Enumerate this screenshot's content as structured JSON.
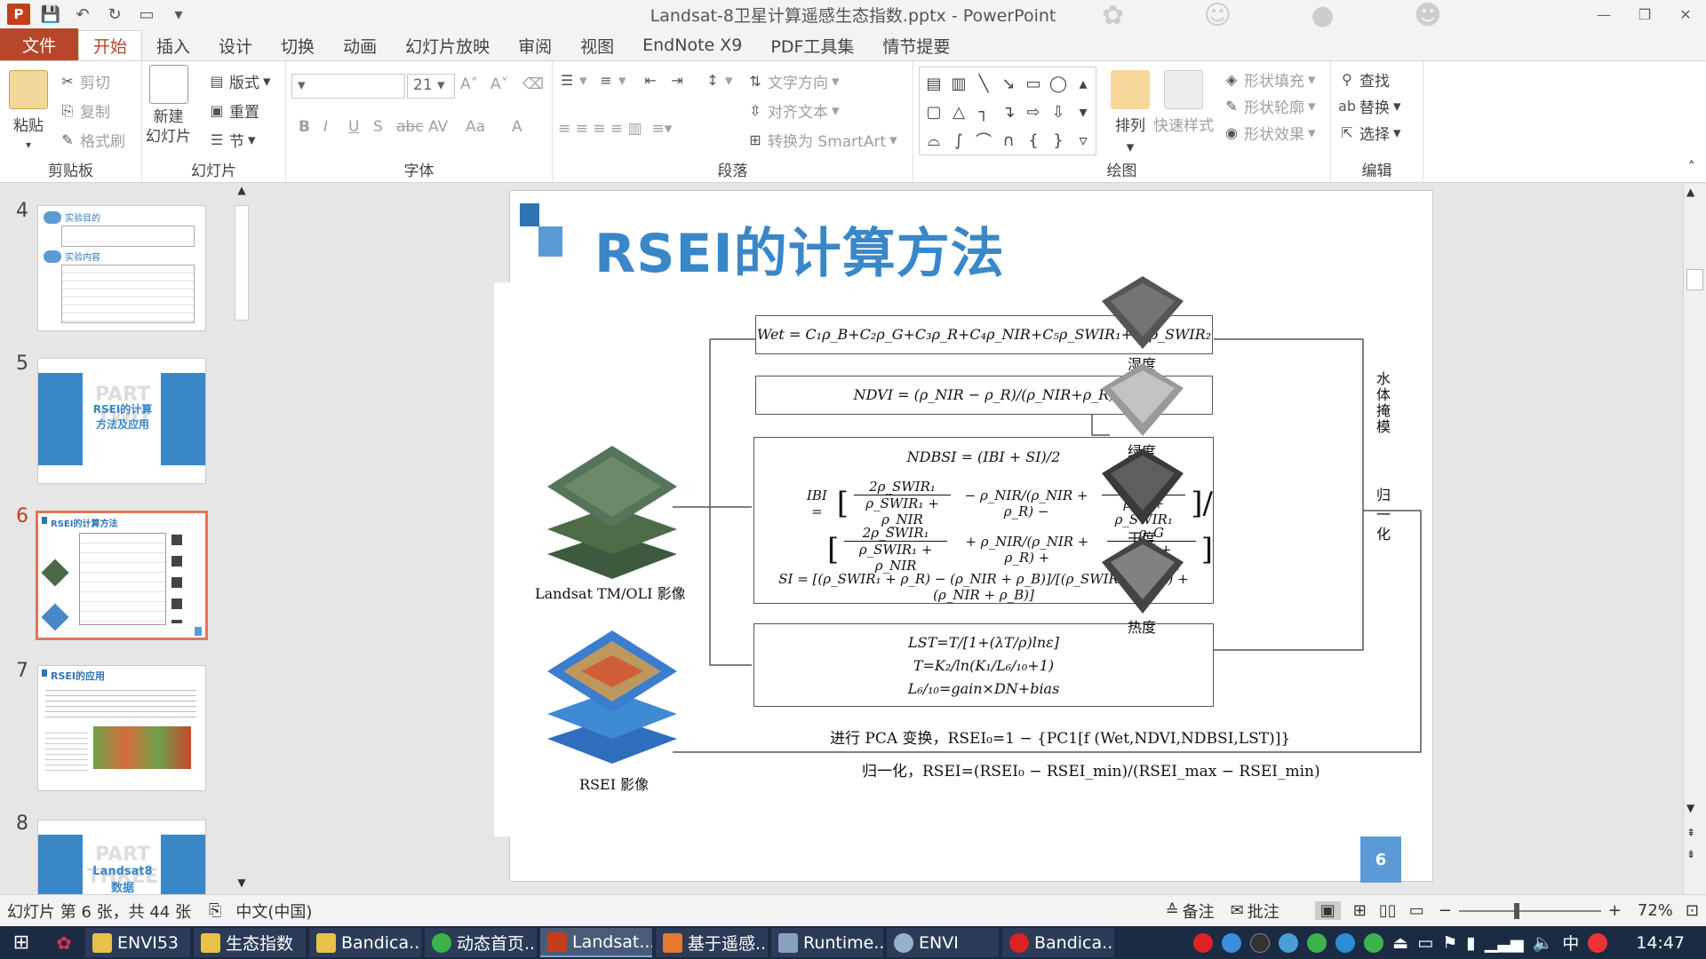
{
  "app": {
    "title": "Landsat-8卫星计算遥感生态指数.pptx - PowerPoint"
  },
  "tabs": [
    "文件",
    "开始",
    "插入",
    "设计",
    "切换",
    "动画",
    "幻灯片放映",
    "审阅",
    "视图",
    "EndNote X9",
    "PDF工具集",
    "情节提要"
  ],
  "ribbon": {
    "clipboard": {
      "paste": "粘贴",
      "cut": "剪切",
      "copy": "复制",
      "format_painter": "格式刷",
      "label": "剪贴板"
    },
    "slides": {
      "new_slide": "新建\n幻灯片",
      "layout": "版式",
      "reset": "重置",
      "section": "节",
      "label": "幻灯片"
    },
    "font": {
      "size": "21",
      "label": "字体",
      "bold": "B",
      "italic": "I",
      "underline": "U",
      "shadow": "S",
      "strike": "abc",
      "spacing": "AV",
      "case": "Aa",
      "color": "A"
    },
    "paragraph": {
      "text_direction": "文字方向",
      "align_text": "对齐文本",
      "smartart": "转换为 SmartArt",
      "label": "段落"
    },
    "drawing": {
      "arrange": "排列",
      "quick_styles": "快速样式",
      "shape_fill": "形状填充",
      "shape_outline": "形状轮廓",
      "shape_effects": "形状效果",
      "label": "绘图"
    },
    "editing": {
      "find": "查找",
      "replace": "替换",
      "select": "选择",
      "label": "编辑"
    }
  },
  "thumbnails": [
    {
      "num": "4",
      "h1": "实验目的",
      "h2": "实验内容"
    },
    {
      "num": "5",
      "text": "RSEI的计算方法及应用",
      "bg": "PART TWO"
    },
    {
      "num": "6",
      "text": "RSEI的计算方法"
    },
    {
      "num": "7",
      "text": "RSEI的应用"
    },
    {
      "num": "8",
      "text": "Landsat8 数据",
      "bg": "PART THREE"
    }
  ],
  "slide": {
    "title": "RSEI的计算方法",
    "page": "6",
    "wet": "Wet = C₁ρ_B+C₂ρ_G+C₃ρ_R+C₄ρ_NIR+C₅ρ_SWIR₁+C₆ρ_SWIR₂",
    "ndvi": "NDVI = (ρ_NIR − ρ_R)/(ρ_NIR+ρ_R)",
    "ndbsi": "NDBSI = (IBI + SI)/2",
    "ibi_label": "IBI =",
    "ibi_num_a": "2ρ_SWIR₁",
    "ibi_den_a": "ρ_SWIR₁ + ρ_NIR",
    "ibi_mid1": "− ρ_NIR/(ρ_NIR + ρ_R) −",
    "ibi_num_b": "ρ_G",
    "ibi_den_b": "ρ_G + ρ_SWIR₁",
    "ibi_mid2": "+ ρ_NIR/(ρ_NIR + ρ_R) +",
    "si": "SI = [(ρ_SWIR₁ + ρ_R) − (ρ_NIR + ρ_B)]/[(ρ_SWIR₁ + ρ_R) + (ρ_NIR + ρ_B)]",
    "lst1": "LST=T/[1+(λT/ρ)lnε]",
    "lst2": "T=K₂/ln(K₁/L₆/₁₀+1)",
    "lst3": "L₆/₁₀=gain×DN+bias",
    "pca": "进行 PCA 变换，RSEI₀=1 − {PC1[f (Wet,NDVI,NDBSI,LST)]}",
    "norm": "归一化，RSEI=(RSEI₀ − RSEI_min)/(RSEI_max − RSEI_min)",
    "landsat_label": "Landsat TM/OLI 影像",
    "rsei_label": "RSEI 影像",
    "humidity": "湿度",
    "greenness": "绿度",
    "dryness": "干度",
    "heat": "热度",
    "water_mask": "水体掩模",
    "normalize": "归一化"
  },
  "status": {
    "slide_info": "幻灯片 第 6 张，共 44 张",
    "lang": "中文(中国)",
    "notes": "备注",
    "comments": "批注",
    "zoom": "72%"
  },
  "taskbar": {
    "items": [
      "ENVI53",
      "生态指数",
      "Bandica...",
      "动态首页...",
      "Landsat...",
      "基于遥感...",
      "Runtime...",
      "ENVI",
      "Bandica..."
    ],
    "time": "14:47",
    "ime": "中"
  }
}
